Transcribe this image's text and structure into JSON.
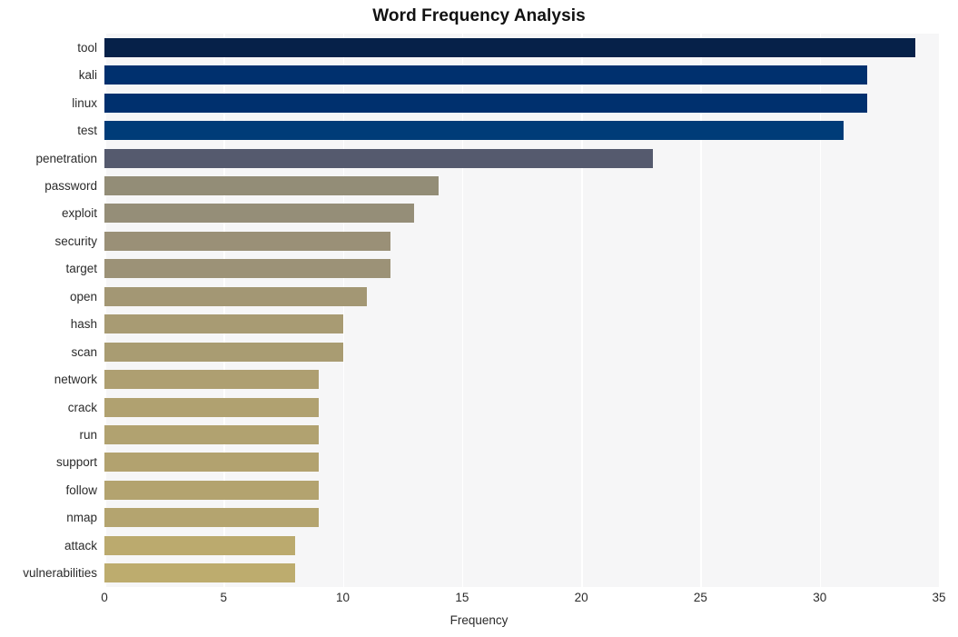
{
  "chart_data": {
    "type": "bar",
    "orientation": "horizontal",
    "title": "Word Frequency Analysis",
    "xlabel": "Frequency",
    "ylabel": "",
    "categories": [
      "tool",
      "kali",
      "linux",
      "test",
      "penetration",
      "password",
      "exploit",
      "security",
      "target",
      "open",
      "hash",
      "scan",
      "network",
      "crack",
      "run",
      "support",
      "follow",
      "nmap",
      "attack",
      "vulnerabilities"
    ],
    "values": [
      34,
      32,
      32,
      31,
      23,
      14,
      13,
      12,
      12,
      11,
      10,
      10,
      9,
      9,
      9,
      9,
      9,
      9,
      8,
      8
    ],
    "bar_colors": [
      "#062149",
      "#00306e",
      "#00306e",
      "#003c78",
      "#555a6e",
      "#938d77",
      "#958e78",
      "#9a9077",
      "#9c9277",
      "#a39774",
      "#a89b73",
      "#a99c72",
      "#ae9f71",
      "#b0a170",
      "#b1a270",
      "#b2a26f",
      "#b3a36f",
      "#b4a46f",
      "#bbaa6e",
      "#bdac6e"
    ],
    "xlim": [
      0,
      35
    ],
    "xticks": [
      0,
      5,
      10,
      15,
      20,
      25,
      30,
      35
    ],
    "xtick_labels": [
      "0",
      "5",
      "10",
      "15",
      "20",
      "25",
      "30",
      "35"
    ],
    "grid": true,
    "grid_axis": "x",
    "grid_color": "#ffffff",
    "plot_background": "#f6f6f7",
    "figure_background": "#ffffff",
    "legend": null,
    "style": "seaborn-whitegrid"
  }
}
